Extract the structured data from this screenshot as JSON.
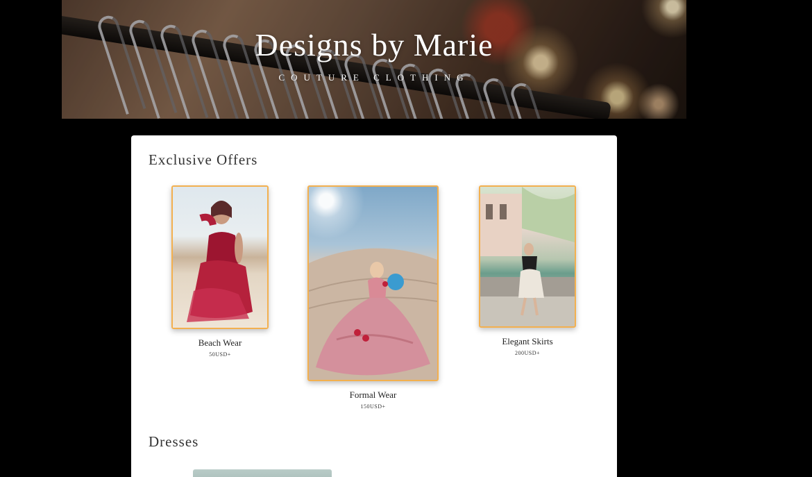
{
  "hero": {
    "title": "Designs by Marie",
    "subtitle": "COUTURE CLOTHING"
  },
  "offers": {
    "heading": "Exclusive Offers",
    "items": [
      {
        "name": "Beach Wear",
        "price": "50USD+"
      },
      {
        "name": "Formal Wear",
        "price": "150USD+"
      },
      {
        "name": "Elegant Skirts",
        "price": "200USD+"
      }
    ]
  },
  "dresses": {
    "heading": "Dresses"
  },
  "colors": {
    "accent_border": "#f3b04f",
    "page_background": "#000000",
    "card_background": "#ffffff"
  }
}
